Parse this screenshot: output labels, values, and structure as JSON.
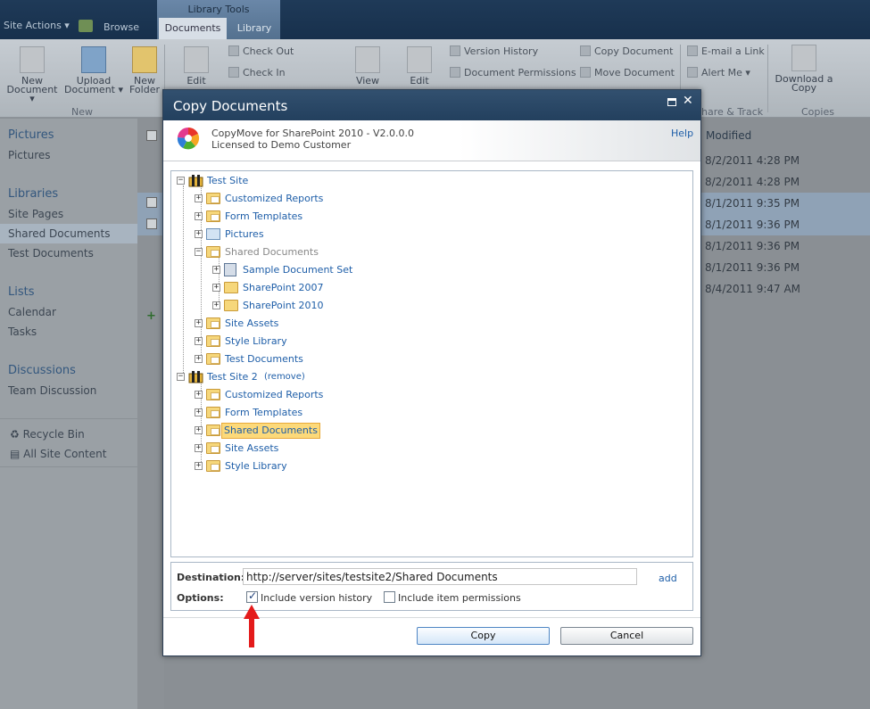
{
  "ribbon": {
    "site_actions": "Site Actions ▾",
    "tab_browse": "Browse",
    "library_tools": "Library Tools",
    "tab_documents": "Documents",
    "tab_library": "Library",
    "new_document": "New Document ▾",
    "new_document_l1": "New",
    "new_document_l2": "Document ▾",
    "upload_l1": "Upload",
    "upload_l2": "Document ▾",
    "new_folder_l1": "New",
    "new_folder_l2": "Folder",
    "edit_label": "Edit",
    "check_out": "Check Out",
    "check_in": "Check In",
    "view_label": "View",
    "edit2_label": "Edit",
    "version_history": "Version History",
    "document_permissions": "Document Permissions",
    "copy_document": "Copy Document",
    "move_document": "Move Document",
    "email_link": "E-mail a Link",
    "alert_me": "Alert Me ▾",
    "download_copy_l1": "Download a",
    "download_copy_l2": "Copy",
    "group_new": "New",
    "group_share": "hare & Track",
    "group_copies": "Copies"
  },
  "leftnav": {
    "pictures_head": "Pictures",
    "pictures": "Pictures",
    "libraries_head": "Libraries",
    "site_pages": "Site Pages",
    "shared_documents": "Shared Documents",
    "test_documents": "Test Documents",
    "lists_head": "Lists",
    "calendar": "Calendar",
    "tasks": "Tasks",
    "discussions_head": "Discussions",
    "team_discussion": "Team Discussion",
    "recycle_bin": "Recycle Bin",
    "all_site_content": "All Site Content"
  },
  "list": {
    "modified_header": "Modified",
    "rows": [
      "8/2/2011 4:28 PM",
      "8/2/2011 4:28 PM",
      "8/1/2011 9:35 PM",
      "8/1/2011 9:36 PM",
      "8/1/2011 9:36 PM",
      "8/1/2011 9:36 PM",
      "8/4/2011 9:47 AM"
    ]
  },
  "dialog": {
    "title": "Copy Documents",
    "product": "CopyMove for SharePoint 2010 - V2.0.0.0",
    "license": "Licensed to Demo Customer",
    "help": "Help",
    "tree": {
      "site1": "Test Site",
      "site1_items": [
        "Customized Reports",
        "Form Templates",
        "Pictures",
        "Shared Documents",
        "Sample Document Set",
        "SharePoint 2007",
        "SharePoint 2010",
        "Site Assets",
        "Style Library",
        "Test Documents"
      ],
      "site2": "Test Site 2",
      "remove": "(remove)",
      "site2_items": [
        "Customized Reports",
        "Form Templates",
        "Shared Documents",
        "Site Assets",
        "Style Library"
      ]
    },
    "destination_label": "Destination:",
    "destination_value": "http://server/sites/testsite2/Shared Documents",
    "add": "add",
    "options_label": "Options:",
    "opt_version_history": "Include version history",
    "opt_version_history_checked": true,
    "opt_item_permissions": "Include item permissions",
    "opt_item_permissions_checked": false,
    "copy_button": "Copy",
    "cancel_button": "Cancel"
  },
  "colors": {
    "link": "#1e5ea8",
    "selected_node": "#fcd97a",
    "title_bar": "#23405e",
    "arrow": "#e41b1b"
  }
}
